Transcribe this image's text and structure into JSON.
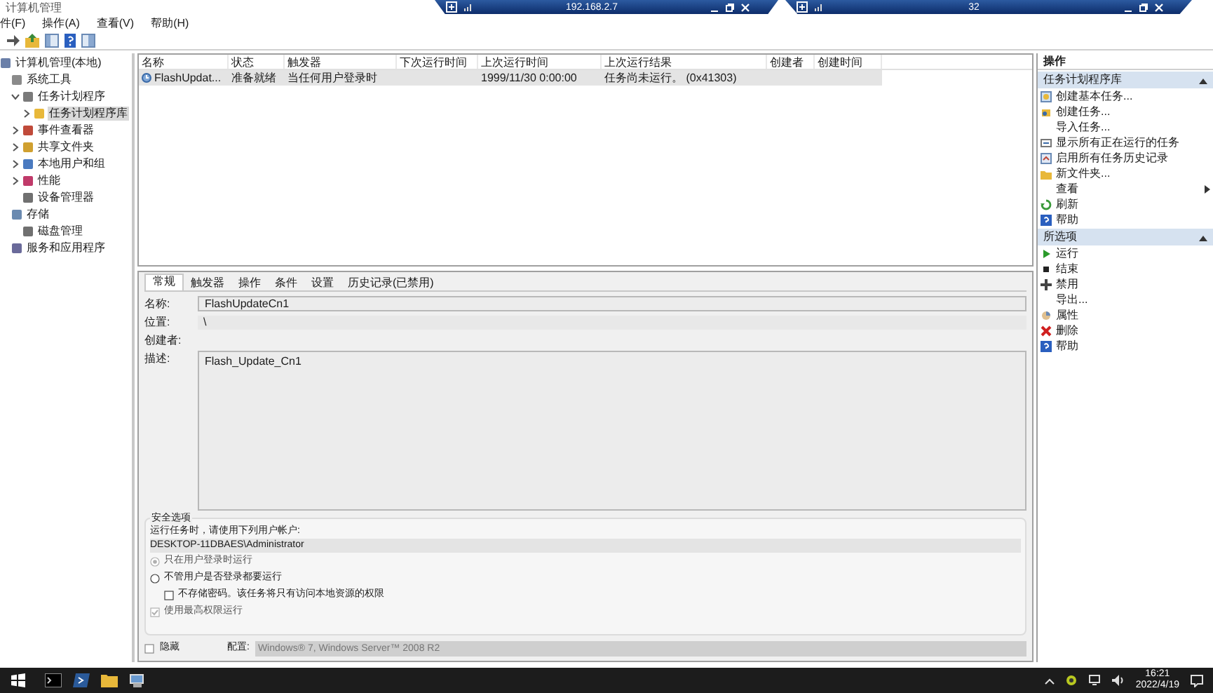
{
  "remote_bars": [
    {
      "title": "192.168.2.7"
    },
    {
      "title": "32"
    }
  ],
  "window": {
    "title": "计算机管理"
  },
  "menu": [
    "件(F)",
    "操作(A)",
    "查看(V)",
    "帮助(H)"
  ],
  "tree": [
    {
      "label": "计算机管理(本地)",
      "selected": false,
      "children": [
        {
          "label": "系统工具",
          "selected": false,
          "children": [
            {
              "label": "任务计划程序",
              "expanded": true,
              "selected": false,
              "children": [
                {
                  "label": "任务计划程序库",
                  "expanded": false,
                  "selected": true
                }
              ]
            },
            {
              "label": "事件查看器",
              "expanded": false,
              "selected": false
            },
            {
              "label": "共享文件夹",
              "expanded": false,
              "selected": false
            },
            {
              "label": "本地用户和组",
              "expanded": false,
              "selected": false
            },
            {
              "label": "性能",
              "expanded": false,
              "selected": false
            },
            {
              "label": "设备管理器",
              "selected": false
            }
          ]
        },
        {
          "label": "存储",
          "selected": false,
          "children": [
            {
              "label": "磁盘管理",
              "selected": false
            }
          ]
        },
        {
          "label": "服务和应用程序",
          "selected": false
        }
      ]
    }
  ],
  "table": {
    "columns": [
      "名称",
      "状态",
      "触发器",
      "下次运行时间",
      "上次运行时间",
      "上次运行结果",
      "创建者",
      "创建时间"
    ],
    "rows": [
      {
        "cells": [
          {
            "text": "FlashUpdat..."
          },
          {
            "text": "准备就绪"
          },
          {
            "text": "当任何用户登录时"
          },
          {},
          {
            "text": "1999/11/30 0:00:00"
          },
          {
            "text": "任务尚未运行。 (0x41303)"
          }
        ],
        "selected": true
      }
    ]
  },
  "detail": {
    "tabs": [
      {
        "label": "常规",
        "selected": true
      },
      {
        "label": "触发器",
        "selected": false
      },
      {
        "label": "操作",
        "selected": false
      },
      {
        "label": "条件",
        "selected": false
      },
      {
        "label": "设置",
        "selected": false
      },
      {
        "label": "历史记录(已禁用)",
        "selected": false
      }
    ],
    "name_label": "名称:",
    "name_value": "FlashUpdateCn1",
    "location_label": "位置:",
    "location_value": "\\",
    "author_label": "创建者:",
    "description_label": "描述:",
    "description_value": "Flash_Update_Cn1",
    "security": {
      "legend": "安全选项",
      "prompt": "运行任务时，请使用下列用户帐户:",
      "account": "DESKTOP-11DBAES\\Administrator",
      "options": [
        {
          "kind": "radio",
          "label": "只在用户登录时运行",
          "selected": true,
          "disabled": true
        },
        {
          "kind": "radio",
          "label": "不管用户是否登录都要运行",
          "selected": false,
          "disabled": false,
          "children": [
            {
              "kind": "checkbox",
              "label": "不存储密码。该任务将只有访问本地资源的权限",
              "checked": false,
              "disabled": false
            }
          ]
        },
        {
          "kind": "checkbox",
          "label": "使用最高权限运行",
          "checked": true,
          "disabled": true
        }
      ]
    },
    "hidden": {
      "label": "隐藏",
      "checked": false
    },
    "config_label": "配置:",
    "config_value": "Windows® 7, Windows Server™ 2008 R2"
  },
  "actions": {
    "title": "操作",
    "sections": [
      {
        "title": "任务计划程序库",
        "items": [
          {
            "label": "创建基本任务..."
          },
          {
            "label": "创建任务..."
          },
          {
            "label": "导入任务..."
          },
          {
            "label": "显示所有正在运行的任务"
          },
          {
            "label": "启用所有任务历史记录"
          },
          {
            "label": "新文件夹..."
          },
          {
            "label": "查看",
            "submenu": true
          },
          {
            "label": "刷新"
          },
          {
            "label": "帮助"
          }
        ]
      },
      {
        "title": "所选项",
        "items": [
          {
            "label": "运行"
          },
          {
            "label": "结束"
          },
          {
            "label": "禁用"
          },
          {
            "label": "导出..."
          },
          {
            "label": "属性"
          },
          {
            "label": "删除"
          },
          {
            "label": "帮助"
          }
        ]
      }
    ]
  },
  "taskbar": {
    "time": "16:21",
    "date": "2022/4/19"
  }
}
